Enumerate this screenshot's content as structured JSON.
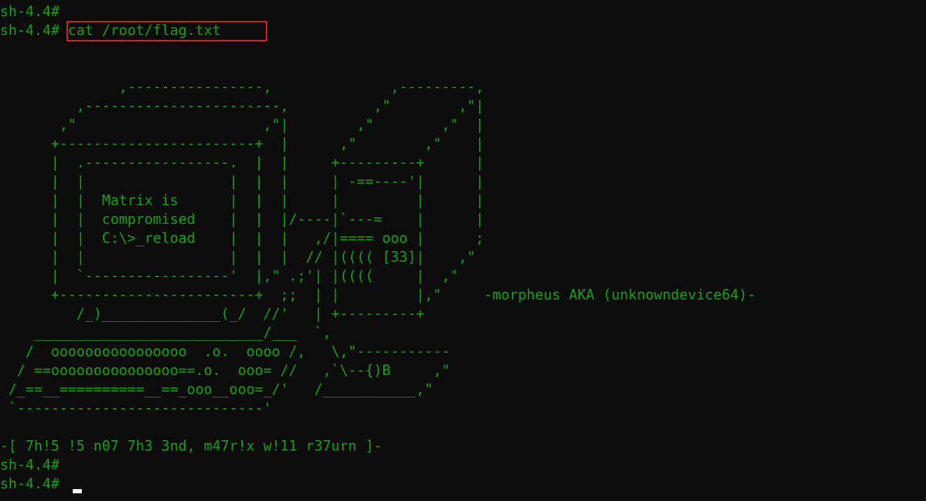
{
  "terminal": {
    "prompt_1": "sh-4.4#",
    "prompt_2": "sh-4.4#",
    "command": " cat /root/flag.txt",
    "art": [
      "",
      "",
      "              ,----------------,              ,---------,",
      "         ,-----------------------,          ,\"        ,\"|",
      "       ,\"                      ,\"|        ,\"        ,\"  |",
      "      +-----------------------+  |      ,\"        ,\"    |",
      "      |  .-----------------.  |  |     +---------+      |",
      "      |  |                 |  |  |     | -==----'|      |",
      "      |  |  Matrix is      |  |  |     |         |      |",
      "      |  |  compromised    |  |  |/----|`---=    |      |",
      "      |  |  C:\\>_reload    |  |  |   ,/|==== ooo |      ;",
      "      |  |                 |  |  |  // |(((( [33]|    ,\"",
      "      |  `-----------------'  |,\" .;'| |((((     |  ,\"",
      "      +-----------------------+  ;;  | |         |,\"     -morpheus AKA (unknowndevice64)-",
      "         /_)______________(_/  //'   | +---------+",
      "    ___________________________/___  `,",
      "   /  oooooooooooooooo  .o.  oooo /,   \\,\"-----------",
      "  / ==ooooooooooooooo==.o.  ooo= //   ,`\\--{)B     ,\"",
      " /_==__==========__==_ooo__ooo=_/'   /___________,\"",
      " `-----------------------------'",
      "",
      "-[ 7h!5 !5 n07 7h3 3nd, m47r!x w!11 r37urn ]-"
    ],
    "prompt_3": "sh-4.4#",
    "prompt_4": "sh-4.4#",
    "colors": {
      "background": "#0c0c0c",
      "text": "#13a10e",
      "highlight_box": "#e02020",
      "cursor": "#ffffff"
    }
  }
}
